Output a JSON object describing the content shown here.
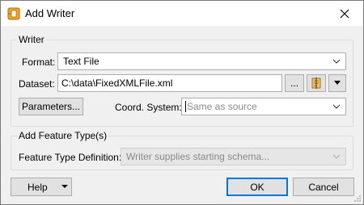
{
  "window": {
    "title": "Add Writer",
    "icons": {
      "app": "fme-writer-icon",
      "close": "close-icon"
    }
  },
  "writer_group": {
    "label": "Writer",
    "format": {
      "label": "Format:",
      "value": "Text File"
    },
    "dataset": {
      "label": "Dataset:",
      "value": "C:\\data\\FixedXMLFile.xml",
      "browse_label": "..."
    },
    "parameters_label": "Parameters...",
    "coord_system": {
      "label": "Coord. System:",
      "placeholder": "Same as source"
    }
  },
  "feature_group": {
    "label": "Add Feature Type(s)",
    "definition": {
      "label": "Feature Type Definition:",
      "value": "Writer supplies starting schema..."
    }
  },
  "footer": {
    "help_label": "Help",
    "ok_label": "OK",
    "cancel_label": "Cancel"
  },
  "colors": {
    "accent": "#0078d7",
    "dialog_bg": "#f0f0f0",
    "icon_orange": "#f5a623"
  }
}
